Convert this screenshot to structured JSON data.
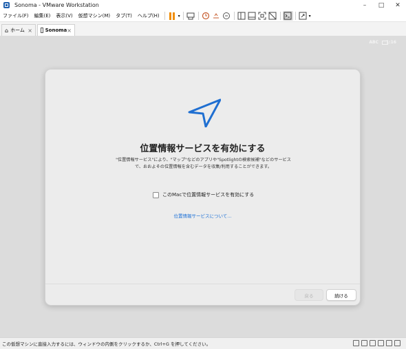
{
  "window": {
    "title": "Sonoma - VMware Workstation"
  },
  "menu": [
    "ファイル(F)",
    "編集(E)",
    "表示(V)",
    "仮想マシン(M)",
    "タブ(T)",
    "ヘルプ(H)"
  ],
  "tabs": [
    {
      "label": "ホーム"
    },
    {
      "label": "Sonoma"
    }
  ],
  "vm": {
    "keyboard": "ABC",
    "time": "1:16"
  },
  "dialog": {
    "title": "位置情報サービスを有効にする",
    "description": "\"位置情報サービス\"により、\"マップ\"などのアプリや\"Spotlightの検索候補\"などのサービスで、おおよその位置情報を含むデータを収集/利用することができます。",
    "checkbox_label": "このMacで位置情報サービスを有効にする",
    "link": "位置情報サービスについて...",
    "back_button": "戻る",
    "continue_button": "続ける"
  },
  "status": {
    "text": "この仮想マシンに直接入力するには、ウィンドウの内側をクリックするか、Ctrl+G を押してください。"
  },
  "colors": {
    "accent": "#1a6fd6",
    "arrow": "#1f6fd1",
    "pause": "#f08c00"
  }
}
